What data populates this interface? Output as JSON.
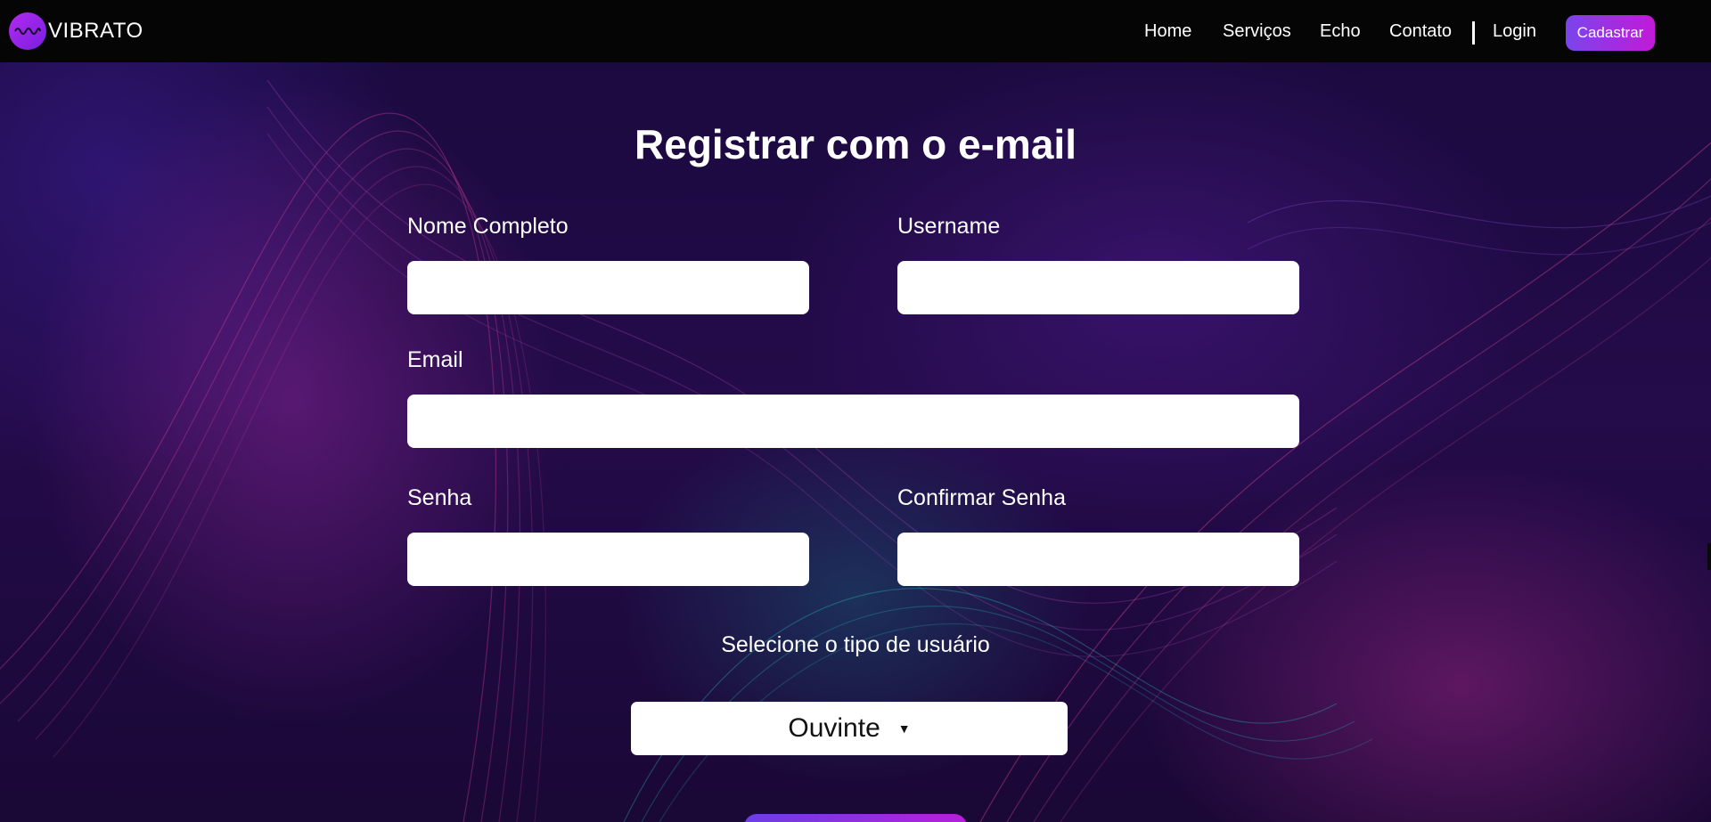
{
  "brand": {
    "name": "VIBRATO",
    "logo_icon": "sound-wave-icon",
    "logo_color": "#a825ec"
  },
  "nav": {
    "home": "Home",
    "servicos": "Serviços",
    "echo": "Echo",
    "contato": "Contato",
    "login": "Login",
    "cadastrar": "Cadastrar"
  },
  "form": {
    "title": "Registrar com o e-mail",
    "nome_label": "Nome Completo",
    "nome_value": "",
    "username_label": "Username",
    "username_value": "",
    "email_label": "Email",
    "email_value": "",
    "senha_label": "Senha",
    "senha_value": "",
    "confirmar_label": "Confirmar Senha",
    "confirmar_value": "",
    "tipo_label": "Selecione o tipo de usuário",
    "tipo_selected": "Ouvinte",
    "tipo_arrow": "▼"
  },
  "colors": {
    "navbar_bg": "#050505",
    "accent_start": "#7a45ea",
    "accent_end": "#c21ad8",
    "page_bg": "#1b0a3f"
  }
}
